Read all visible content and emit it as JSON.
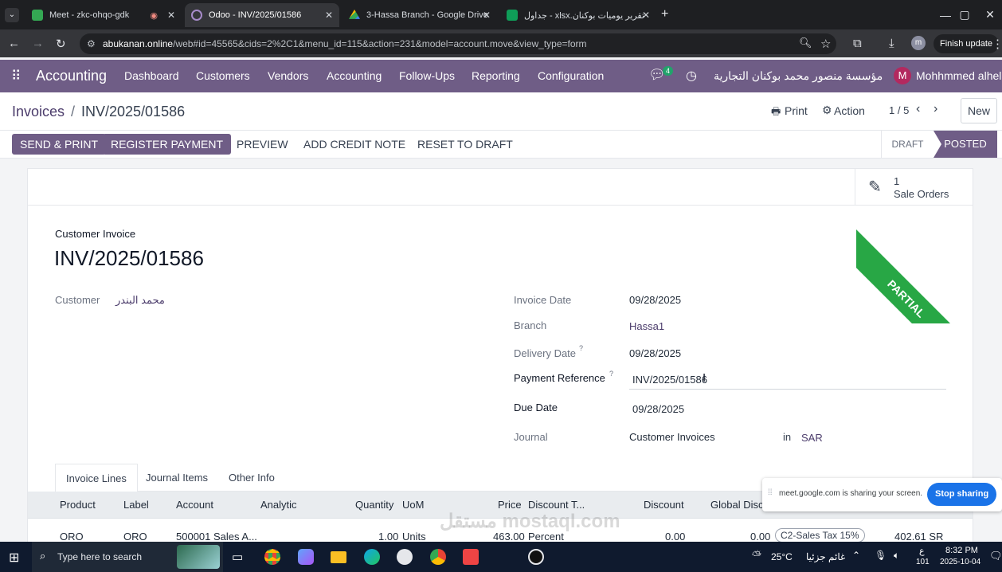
{
  "browser": {
    "tabs": [
      {
        "title": "Meet - zkc-ohqo-gdk",
        "color": "#34a853"
      },
      {
        "title": "Odoo - INV/2025/01586",
        "color": "#6f5d86"
      },
      {
        "title": "3-Hassa Branch - Google Drive",
        "color": "#fbbc04"
      },
      {
        "title": "تقرير يوميات بوكنان.xlsx - جداول",
        "color": "#0f9d58"
      }
    ],
    "url_domain": "abukanan.online",
    "url_path": "/web#id=45565&cids=2%2C1&menu_id=115&action=231&model=account.move&view_type=form",
    "profile_initial": "m",
    "finish_update": "Finish update"
  },
  "nav": {
    "app": "Accounting",
    "menu": [
      "Dashboard",
      "Customers",
      "Vendors",
      "Accounting",
      "Follow-Ups",
      "Reporting",
      "Configuration"
    ],
    "chat_count": "4",
    "company": "مؤسسة منصور محمد بوكنان التجارية",
    "user_initial": "M",
    "user": "Mohhmmed alhelaly"
  },
  "control": {
    "breadcrumb_root": "Invoices",
    "breadcrumb_sep": "/",
    "breadcrumb_current": "INV/2025/01586",
    "print": "Print",
    "action": "Action",
    "pager": "1 / 5",
    "new": "New"
  },
  "statusbar": {
    "send_print": "SEND & PRINT",
    "register_payment": "REGISTER PAYMENT",
    "preview": "PREVIEW",
    "add_credit_note": "ADD CREDIT NOTE",
    "reset_to_draft": "RESET TO DRAFT",
    "stages": [
      "DRAFT",
      "POSTED"
    ]
  },
  "smart_button": {
    "count": "1",
    "label": "Sale Orders"
  },
  "ribbon": "PARTIAL",
  "invoice": {
    "type": "Customer Invoice",
    "number": "INV/2025/01586",
    "customer_label": "Customer",
    "customer": "محمد البندر",
    "fields": [
      {
        "label": "Invoice Date",
        "value": "09/28/2025"
      },
      {
        "label": "Branch",
        "value": "Hassa1"
      },
      {
        "label": "Delivery Date",
        "value": "09/28/2025"
      },
      {
        "label": "Payment Reference",
        "value": "INV/2025/01586"
      },
      {
        "label": "Due Date",
        "value": "09/28/2025"
      },
      {
        "label": "Journal",
        "value": "Customer Invoices"
      }
    ],
    "currency_in": "in",
    "currency": "SAR"
  },
  "tabs": [
    "Invoice Lines",
    "Journal Items",
    "Other Info"
  ],
  "lines": {
    "headers": [
      "Product",
      "Label",
      "Account",
      "Analytic",
      "Quantity",
      "UoM",
      "Price",
      "Discount T...",
      "Discount",
      "Global Disco"
    ],
    "rows": [
      {
        "product": "ORO",
        "label": "ORO",
        "account": "500001 Sales A...",
        "analytic": "",
        "quantity": "1.00",
        "uom": "Units",
        "price": "463.00",
        "discount_type": "Percent",
        "discount": "0.00",
        "global_discount": "0.00",
        "tax": "C2-Sales Tax 15%",
        "subtotal": "402.61 SR"
      }
    ]
  },
  "sharing": {
    "text": "meet.google.com is sharing your screen.",
    "button": "Stop sharing"
  },
  "watermark": "مستقل mostaql.com",
  "taskbar": {
    "search": "Type here to search",
    "weather": "25°C",
    "weather_text": "غائم جزئيا",
    "lang": "ع",
    "lang_sub": "101",
    "time": "8:32 PM",
    "date": "2025-10-04"
  }
}
